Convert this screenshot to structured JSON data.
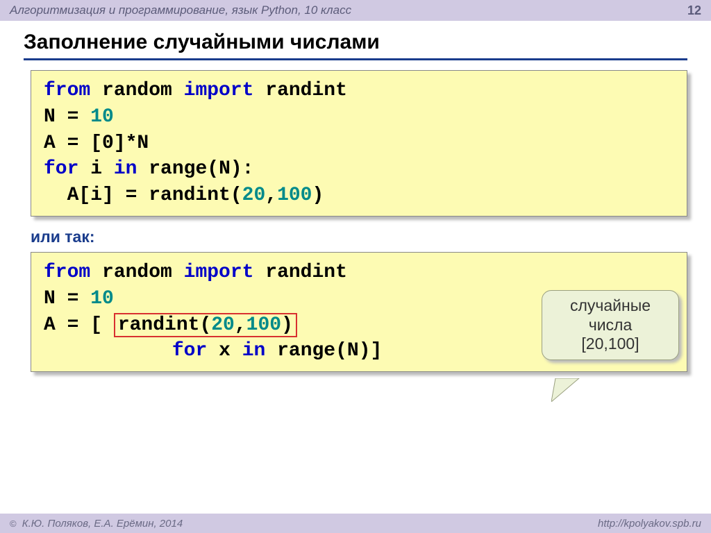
{
  "header": {
    "text": "Алгоритмизация и программирование, язык Python, 10 класс",
    "page": "12"
  },
  "title": "Заполнение случайными числами",
  "code1": {
    "l1_kw1": "from",
    "l1_p1": " random ",
    "l1_kw2": "import",
    "l1_p2": " randint",
    "l2_p1": "N = ",
    "l2_n1": "10",
    "l3": "A = [0]*N",
    "l4_kw1": "for",
    "l4_p1": " i ",
    "l4_kw2": "in",
    "l4_p2": " range(N):",
    "l5_p1": "  A[i] = randint(",
    "l5_n1": "20",
    "l5_p2": ",",
    "l5_n2": "100",
    "l5_p3": ")"
  },
  "subtitle": "или так:",
  "code2": {
    "l1_kw1": "from",
    "l1_p1": " random ",
    "l1_kw2": "import",
    "l1_p2": " randint",
    "l2_p1": "N = ",
    "l2_n1": "10",
    "l3_p1": "A = [ ",
    "l3_p2": "randint(",
    "l3_n1": "20",
    "l3_p3": ",",
    "l3_n2": "100",
    "l3_p4": ")",
    "l4_pad": "           ",
    "l4_kw1": "for",
    "l4_p1": " x ",
    "l4_kw2": "in",
    "l4_p2": " range(N)]"
  },
  "callout": {
    "line1": "случайные",
    "line2": "числа",
    "line3": "[20,100]"
  },
  "footer": {
    "left": "К.Ю. Поляков, Е.А. Ерёмин, 2014",
    "right": "http://kpolyakov.spb.ru"
  }
}
